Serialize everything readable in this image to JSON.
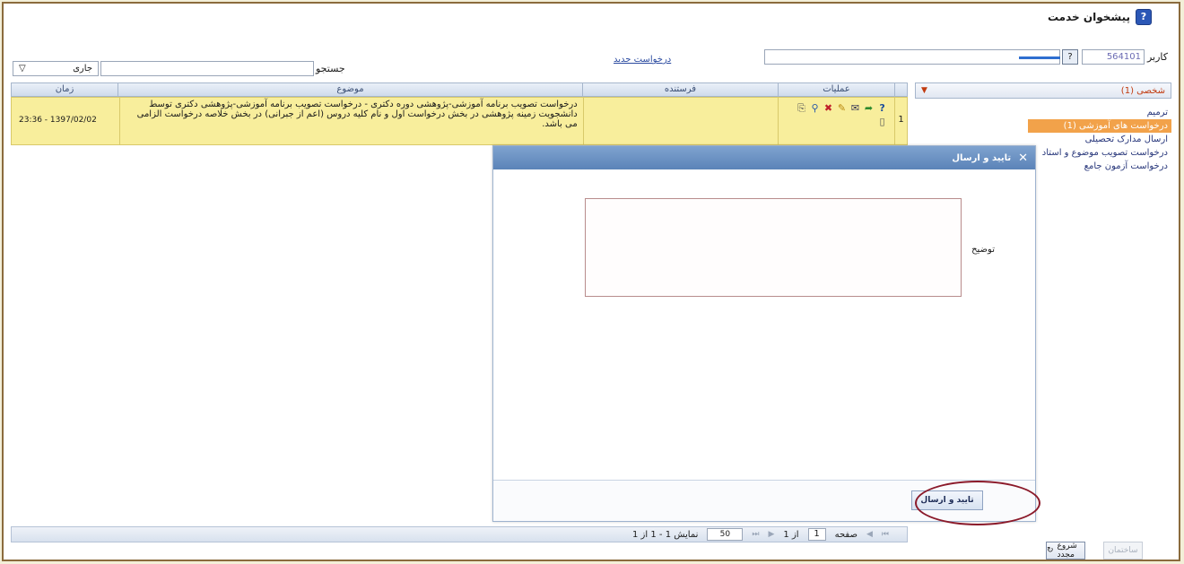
{
  "header": {
    "title": "پیشخوان خدمت",
    "title_icon": "help-icon"
  },
  "user_bar": {
    "user_label": "کاربر",
    "user_value": "564101",
    "help_glyph": "?",
    "new_request_link": "درخواست جدید"
  },
  "filter": {
    "search_label": "جستجو",
    "status_value": "جاری"
  },
  "grid": {
    "columns": [
      "عملیات",
      "فرستنده",
      "موضوع",
      "زمان"
    ],
    "rows": [
      {
        "index": "1",
        "sender": "",
        "subject": "درخواست تصویب برنامه آموزشی-پژوهشی دوره دکتری - درخواست تصویب برنامه آموزشی-پژوهشی دکتری توسط دانشجویت زمینه پژوهشی در بخش درخواست اول و نام کلیه دروس (اعم از جبرانی) در بخش خلاصه درخواست الزامی می باشد.",
        "time": "1397/02/02 - 23:36"
      }
    ]
  },
  "sidebar": {
    "header_label": "شخصی (1)",
    "items": [
      "ترمیم",
      "درخواست های آموزشی (1)",
      "ارسال مدارک تحصیلی",
      "درخواست تصویب موضوع و استاد",
      "درخواست آزمون جامع"
    ]
  },
  "pager": {
    "page_label": "صفحه",
    "page_value": "1",
    "of_label": "از 1",
    "size_value": "50",
    "show_label": "نمایش 1 - 1 از 1"
  },
  "bottom": {
    "restart_label": "شروع مجدد",
    "disabled_label": "ساختمان"
  },
  "modal": {
    "title": "تایید و ارسال",
    "desc_label": "توضیح",
    "submit_label": "تایید و ارسال"
  },
  "colors": {
    "accent": "#5b83b8",
    "row_highlight": "#f8ee9c",
    "active_item": "#f2a24a",
    "annotation_circle": "#8b1a2a"
  }
}
